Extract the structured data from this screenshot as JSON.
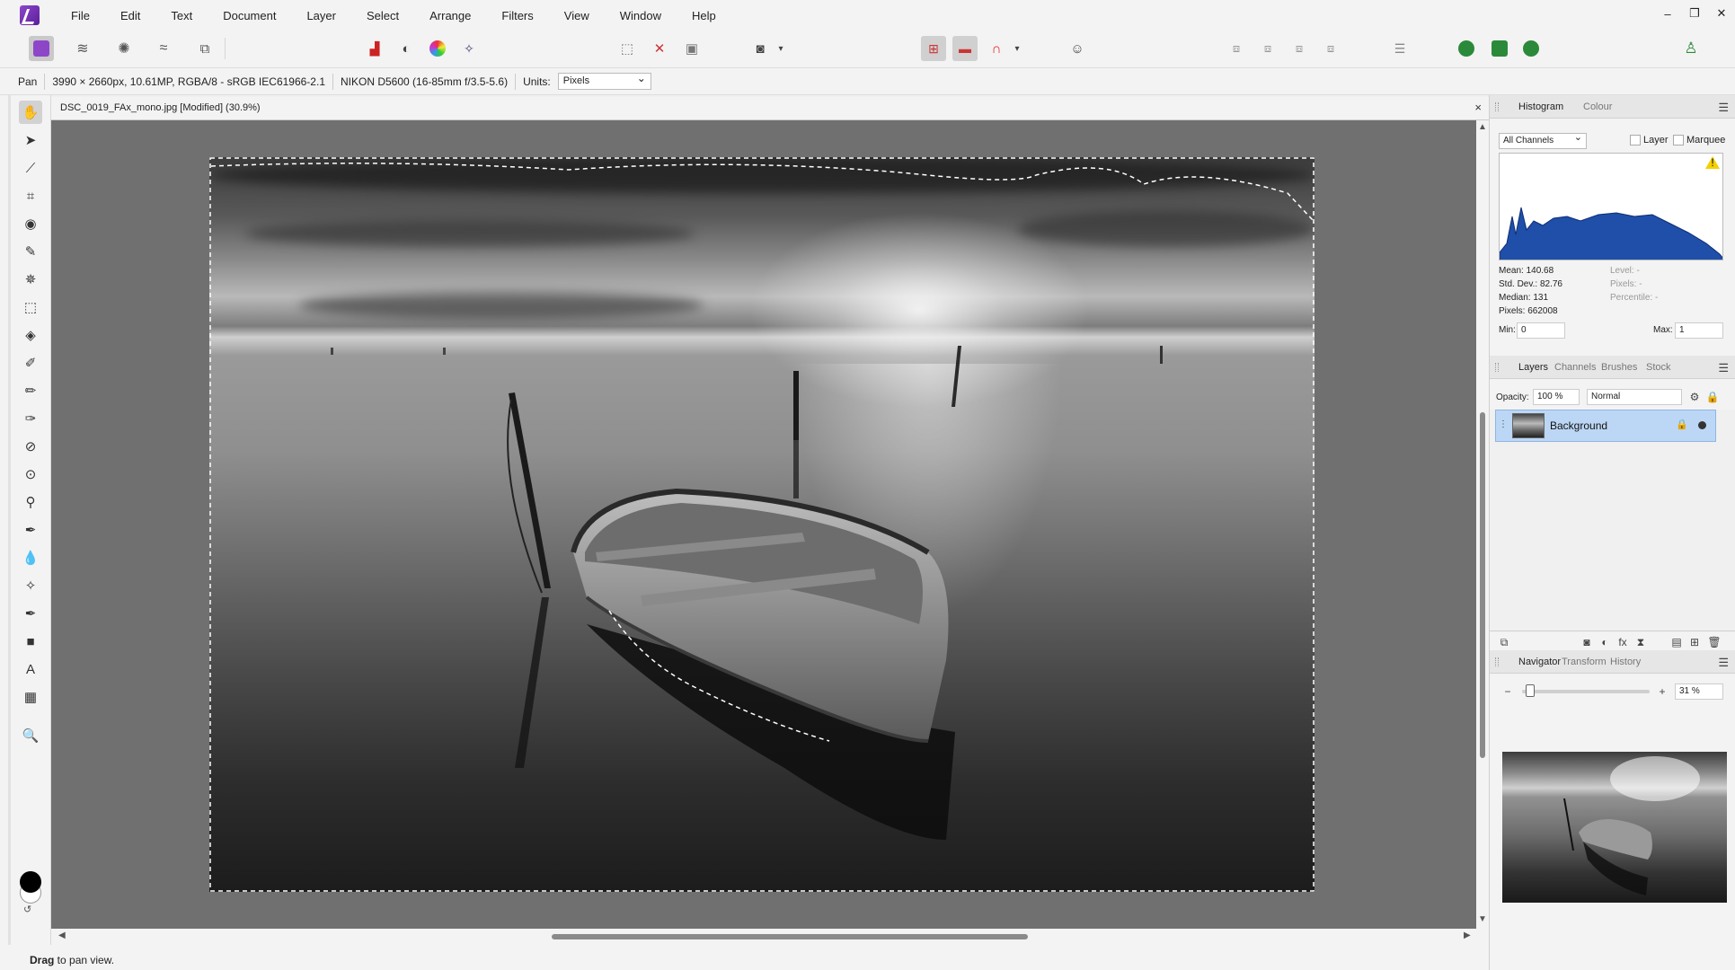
{
  "menu": [
    "File",
    "Edit",
    "Text",
    "Document",
    "Layer",
    "Select",
    "Arrange",
    "Filters",
    "View",
    "Window",
    "Help"
  ],
  "window_controls": {
    "minimize": "‒",
    "restore": "❐",
    "close": "✕"
  },
  "context_bar": {
    "tool": "Pan",
    "image_info": "3990 × 2660px, 10.61MP, RGBA/8 - sRGB IEC61966-2.1",
    "camera": "NIKON D5600 (16-85mm f/3.5-5.6)",
    "units_label": "Units:",
    "units_value": "Pixels"
  },
  "document": {
    "title": "DSC_0019_FAx_mono.jpg [Modified] (30.9%)",
    "close": "×"
  },
  "histogram_panel": {
    "tabs": [
      "Histogram",
      "Colour"
    ],
    "channel": "All Channels",
    "layer_label": "Layer",
    "marquee_label": "Marquee",
    "mean": "Mean: 140.68",
    "std_dev": "Std. Dev.: 82.76",
    "median": "Median: 131",
    "pixels": "Pixels: 662008",
    "level": "Level: -",
    "pixels_sel": "Pixels: -",
    "percentile": "Percentile: -",
    "min_label": "Min:",
    "min_value": "0",
    "max_label": "Max:",
    "max_value": "1",
    "warning": "!"
  },
  "layers_panel": {
    "tabs": [
      "Layers",
      "Channels",
      "Brushes",
      "Stock"
    ],
    "opacity_label": "Opacity:",
    "opacity_value": "100 %",
    "blend_mode": "Normal",
    "layer_name": "Background"
  },
  "navigator_panel": {
    "tabs": [
      "Navigator",
      "Transform",
      "History"
    ],
    "zoom_value": "31 %",
    "zoom_out": "−",
    "zoom_in": "+"
  },
  "status": {
    "bold": "Drag",
    "rest": " to pan view."
  },
  "colors": {
    "accent": "#8e46c9",
    "histogram_fill": "#1f4fa8",
    "selected_layer": "#bcd7f5"
  }
}
